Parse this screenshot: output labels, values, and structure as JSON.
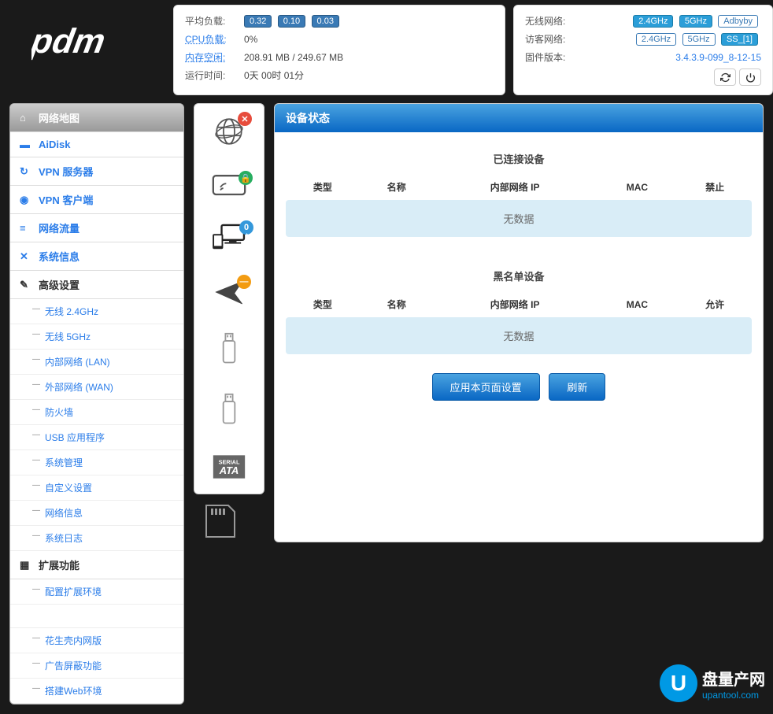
{
  "status_left": {
    "avg_load_label": "平均负载:",
    "avg_load": [
      "0.32",
      "0.10",
      "0.03"
    ],
    "cpu_label": "CPU负载:",
    "cpu_val": "0%",
    "mem_label": "内存空闲:",
    "mem_val": "208.91 MB / 249.67 MB",
    "uptime_label": "运行时间:",
    "uptime_val": "0天 00时 01分"
  },
  "status_right": {
    "wifi_label": "无线网络:",
    "wifi_badges": [
      "2.4GHz",
      "5GHz",
      "Adbyby"
    ],
    "guest_label": "访客网络:",
    "guest_badges": [
      "2.4GHz",
      "5GHz",
      "SS_[1]"
    ],
    "fw_label": "固件版本:",
    "fw_val": "3.4.3.9-099_8-12-15"
  },
  "sidebar": {
    "header": "网络地图",
    "items": [
      {
        "icon": "disk",
        "label": "AiDisk"
      },
      {
        "icon": "vpn",
        "label": "VPN 服务器"
      },
      {
        "icon": "globe",
        "label": "VPN 客户端"
      },
      {
        "icon": "list",
        "label": "网络流量"
      },
      {
        "icon": "shuffle",
        "label": "系统信息"
      }
    ],
    "advanced_label": "高级设置",
    "advanced_subs": [
      "无线 2.4GHz",
      "无线 5GHz",
      "内部网络 (LAN)",
      "外部网络 (WAN)",
      "防火墙",
      "USB 应用程序",
      "系统管理",
      "自定义设置",
      "网络信息",
      "系统日志"
    ],
    "ext_label": "扩展功能",
    "ext_subs": [
      "配置扩展环境"
    ],
    "ext_subs2": [
      "花生壳内网版",
      "广告屏蔽功能",
      "搭建Web环境"
    ]
  },
  "icon_col": {
    "devices_count": "0"
  },
  "panel": {
    "title": "设备状态",
    "connected_title": "已连接设备",
    "cols1": [
      "类型",
      "名称",
      "内部网络 IP",
      "MAC",
      "禁止"
    ],
    "nodata": "无数据",
    "blacklist_title": "黑名单设备",
    "cols2": [
      "类型",
      "名称",
      "内部网络 IP",
      "MAC",
      "允许"
    ],
    "btn_apply": "应用本页面设置",
    "btn_refresh": "刷新"
  },
  "watermark": {
    "letter": "U",
    "text": "盘量产网",
    "url": "upantool.com"
  }
}
